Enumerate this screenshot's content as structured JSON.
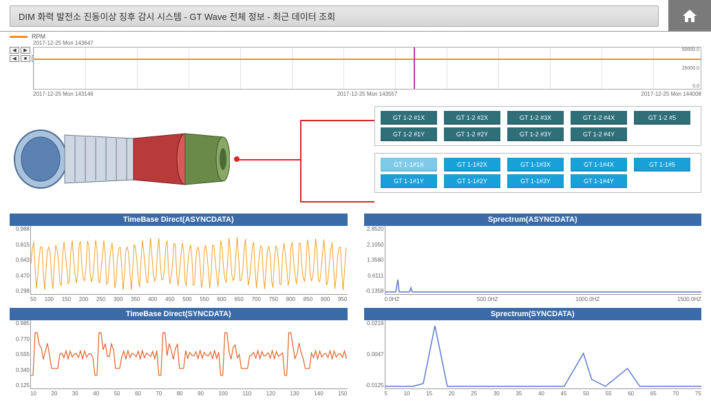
{
  "header": {
    "title": "DIM  화력 발전소 진동이상 징후 감시 시스템 - GT Wave 전체 정보 - 최근 데이터 조회"
  },
  "rpm": {
    "label": "RPM"
  },
  "overview": {
    "tooltip_time": "2017-12-25 Mon 143647",
    "yticks": [
      "50000.0",
      "25000.0",
      "0.0"
    ],
    "xticks": [
      "2017-12-25 Mon 143146",
      "2017-12-25 Mon 143557",
      "2017-12-25 Mon 144008"
    ]
  },
  "sensors": {
    "group1_row1": [
      "GT 1-2 #1X",
      "GT 1-2 #2X",
      "GT 1-2 #3X",
      "GT 1-2 #4X",
      "GT 1-2 #5"
    ],
    "group1_row2": [
      "GT 1-2 #1Y",
      "GT 1-2 #2Y",
      "GT 1-2 #3Y",
      "GT 1-2 #4Y"
    ],
    "group2_row1": [
      "GT 1-1#1X",
      "GT 1-1#2X",
      "GT 1-1#3X",
      "GT 1-1#4X",
      "GT 1-1#5"
    ],
    "group2_row2": [
      "GT 1-1#1Y",
      "GT 1-1#2Y",
      "GT 1-1#3Y",
      "GT 1-1#4Y"
    ]
  },
  "charts": {
    "tb_async": {
      "title": "TimeBase Direct(ASYNCDATA)",
      "yticks": [
        "0.988",
        "0.815",
        "0.643",
        "0.470",
        "0.298"
      ],
      "xticks": [
        "50",
        "100",
        "150",
        "200",
        "250",
        "300",
        "350",
        "400",
        "450",
        "500",
        "550",
        "600",
        "650",
        "700",
        "750",
        "800",
        "850",
        "900",
        "950"
      ]
    },
    "tb_sync": {
      "title": "TimeBase Direct(SYNCDATA)",
      "yticks": [
        "0.985",
        "0.770",
        "0.555",
        "0.340",
        "0.125"
      ],
      "xticks": [
        "10",
        "20",
        "30",
        "40",
        "50",
        "60",
        "70",
        "80",
        "90",
        "100",
        "110",
        "120",
        "130",
        "140",
        "150"
      ]
    },
    "sp_async": {
      "title": "Sprectrum(ASYNCDATA)",
      "yticks": [
        "2.8520",
        "2.1050",
        "1.3580",
        "0.6111",
        "-0.1358"
      ],
      "xticks": [
        "0.0HZ",
        "500.0HZ",
        "1000.0HZ",
        "1500.0HZ"
      ]
    },
    "sp_sync": {
      "title": "Sprectrum(SYNCDATA)",
      "yticks": [
        "0.0219",
        "0.0047",
        "-0.0125"
      ],
      "xticks": [
        "5",
        "10",
        "15",
        "20",
        "25",
        "30",
        "35",
        "40",
        "45",
        "50",
        "55",
        "60",
        "65",
        "70",
        "75"
      ]
    }
  },
  "chart_data": [
    {
      "type": "line",
      "title": "RPM Overview",
      "x_range": [
        "2017-12-25 Mon 143146",
        "2017-12-25 Mon 144008"
      ],
      "ylim": [
        0,
        50000
      ],
      "series": [
        {
          "name": "RPM",
          "value": 41000
        }
      ],
      "cursor_at": "2017-12-25 Mon 143647"
    },
    {
      "type": "line",
      "title": "TimeBase Direct(ASYNCDATA)",
      "xlabel": "",
      "ylabel": "",
      "x": [
        50,
        950
      ],
      "ylim": [
        0.298,
        0.988
      ],
      "note": "dense oscillatory waveform ~40 cycles between ~0.47 and ~0.90"
    },
    {
      "type": "line",
      "title": "TimeBase Direct(SYNCDATA)",
      "x": [
        10,
        150
      ],
      "ylim": [
        0.125,
        0.985
      ],
      "note": "repeating step-like waveform 5 groups, baseline ~0.60 with dips to ~0.20 and peaks to ~0.85"
    },
    {
      "type": "line",
      "title": "Sprectrum(ASYNCDATA)",
      "x_unit": "HZ",
      "xlim": [
        0,
        1500
      ],
      "ylim": [
        -0.1358,
        2.852
      ],
      "peaks": [
        {
          "hz": 60,
          "val": 0.55
        },
        {
          "hz": 120,
          "val": 0.2
        }
      ]
    },
    {
      "type": "line",
      "title": "Sprectrum(SYNCDATA)",
      "xlim": [
        5,
        75
      ],
      "ylim": [
        -0.0125,
        0.0219
      ],
      "peaks": [
        {
          "x": 12,
          "val": 0.02
        },
        {
          "x": 47,
          "val": 0.01
        },
        {
          "x": 58,
          "val": 0.006
        }
      ]
    }
  ]
}
